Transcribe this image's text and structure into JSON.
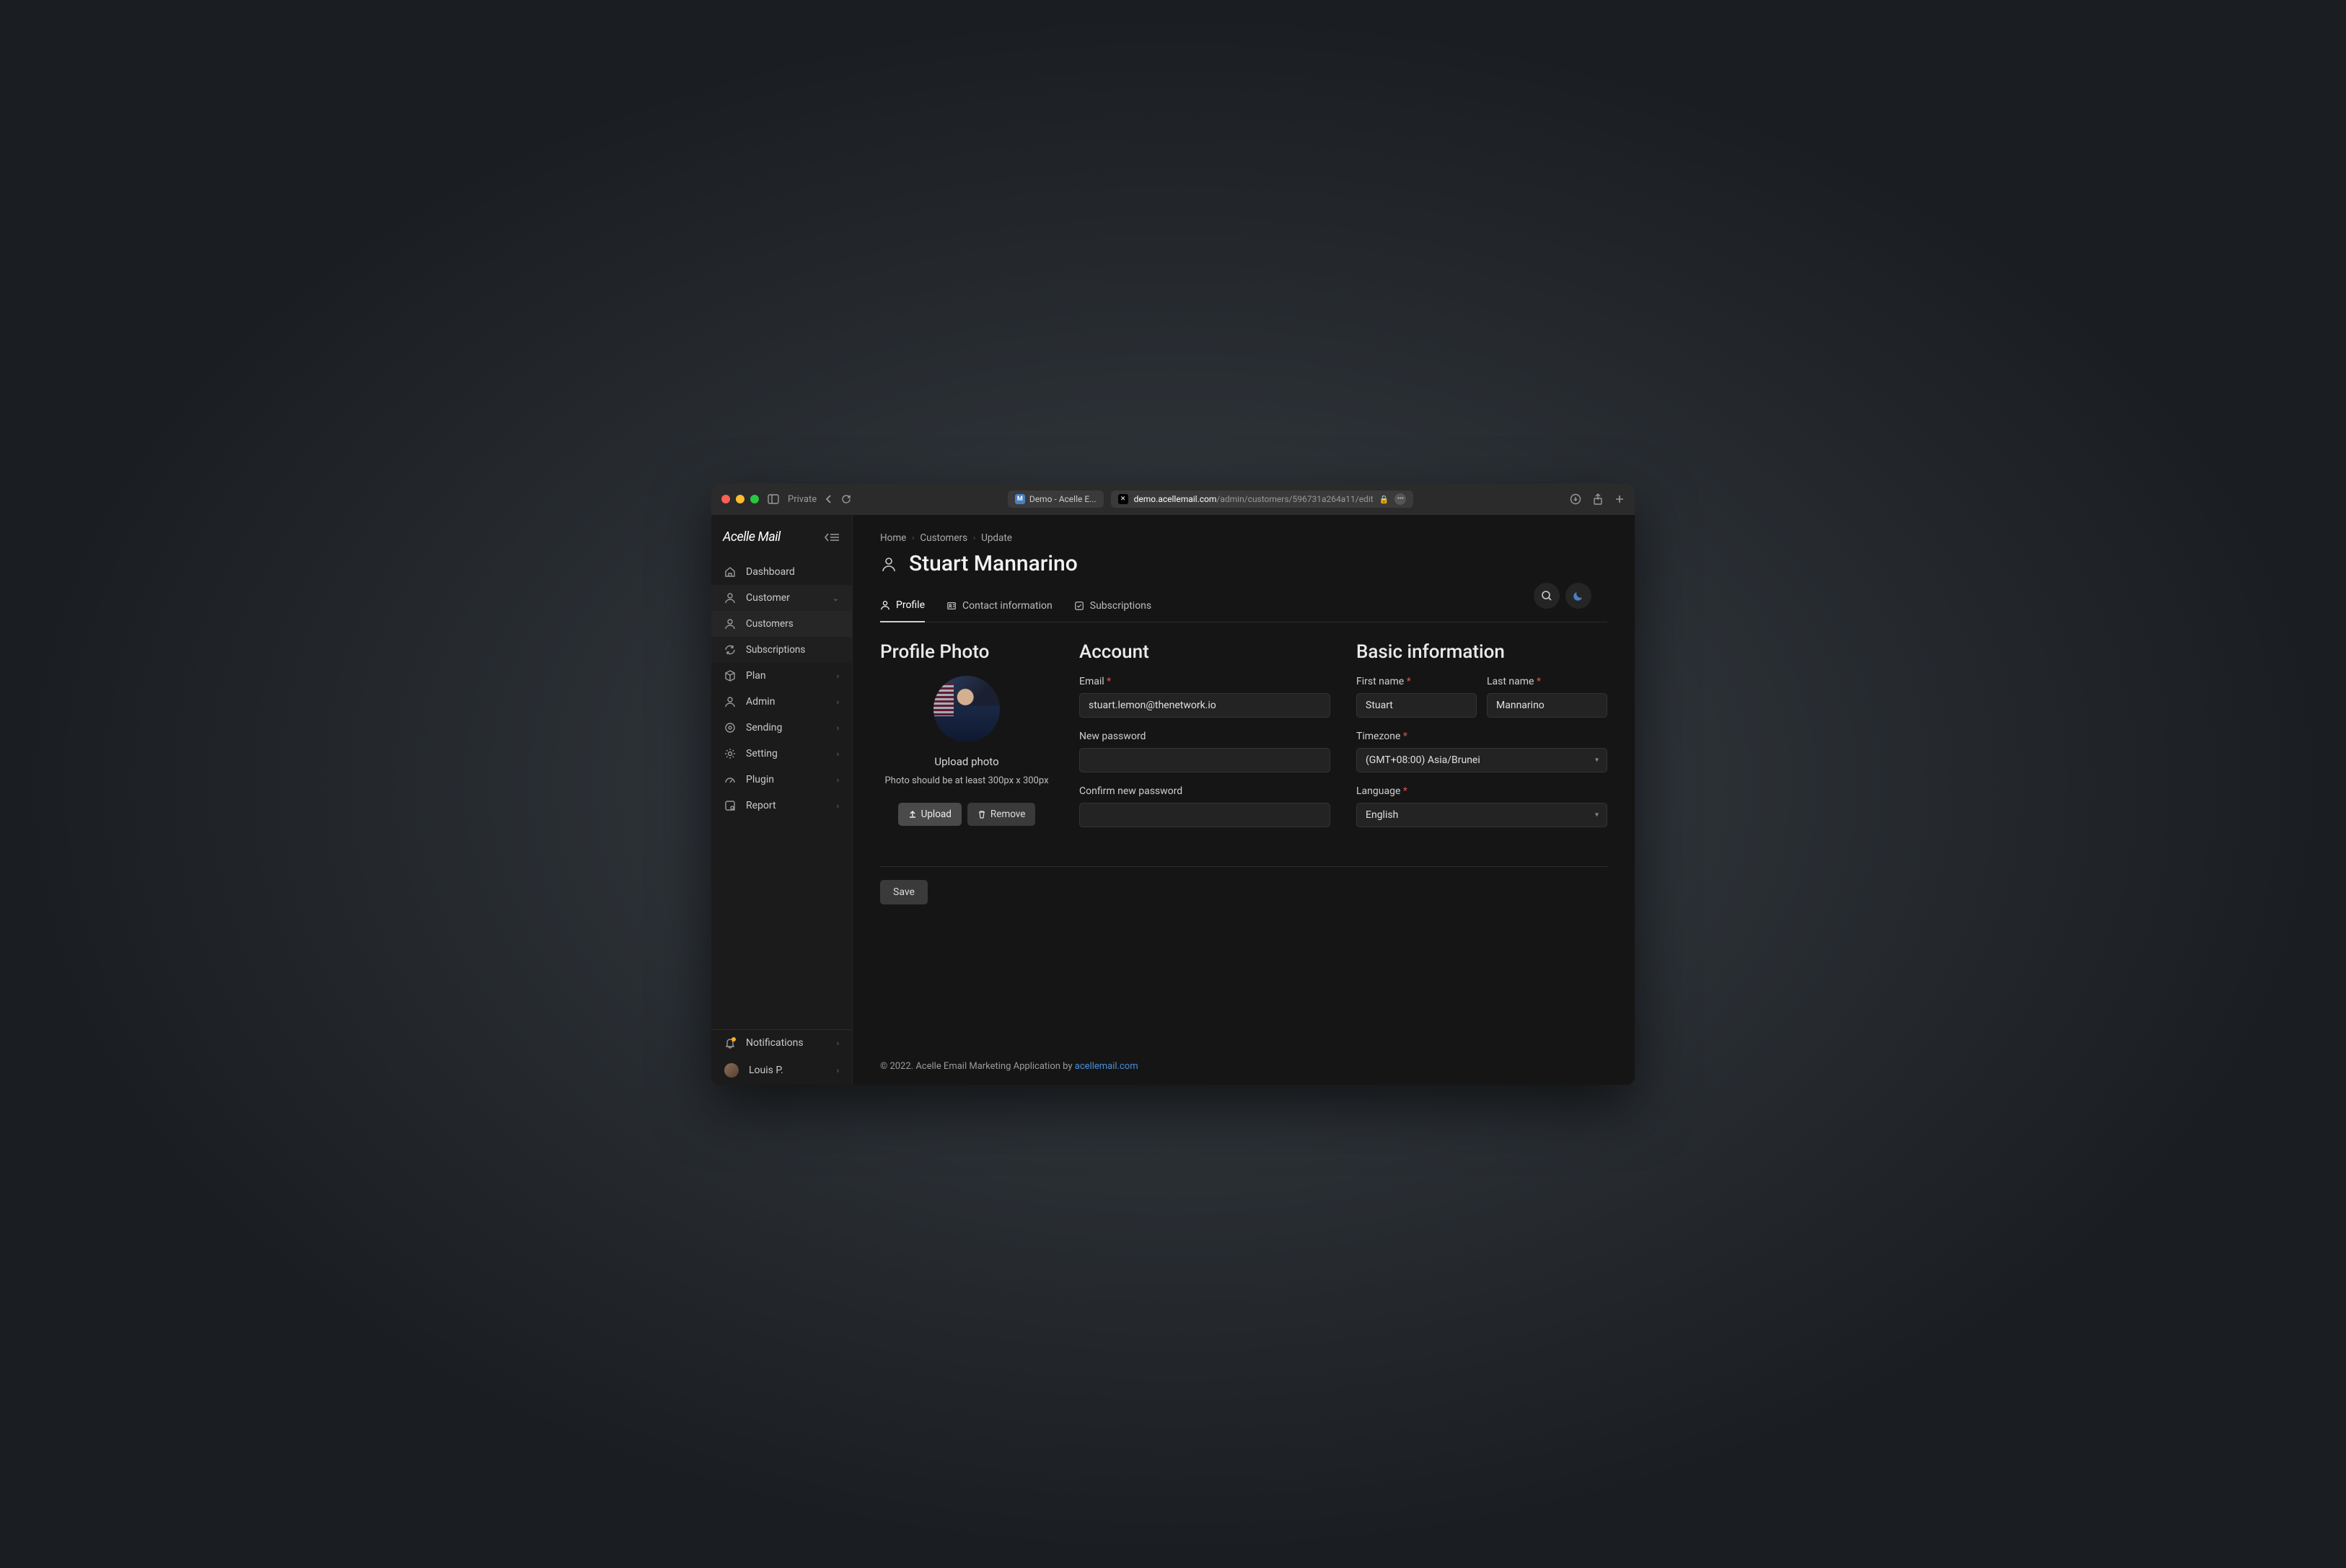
{
  "browser": {
    "private_label": "Private",
    "tab_title": "Demo - Acelle E...",
    "url_domain": "demo.acellemail.com",
    "url_path": "/admin/customers/596731a264a11/edit"
  },
  "logo": "Acelle Mail",
  "sidebar": {
    "items": [
      {
        "label": "Dashboard",
        "icon": "home"
      },
      {
        "label": "Customer",
        "icon": "user",
        "expanded": true,
        "children": [
          {
            "label": "Customers",
            "icon": "user",
            "active": true
          },
          {
            "label": "Subscriptions",
            "icon": "refresh"
          }
        ]
      },
      {
        "label": "Plan",
        "icon": "box",
        "chevron": true
      },
      {
        "label": "Admin",
        "icon": "user",
        "chevron": true
      },
      {
        "label": "Sending",
        "icon": "target",
        "chevron": true
      },
      {
        "label": "Setting",
        "icon": "gear",
        "chevron": true
      },
      {
        "label": "Plugin",
        "icon": "gauge",
        "chevron": true
      },
      {
        "label": "Report",
        "icon": "report",
        "chevron": true
      }
    ],
    "notifications_label": "Notifications",
    "user_name": "Louis P."
  },
  "breadcrumb": [
    "Home",
    "Customers",
    "Update"
  ],
  "page_title": "Stuart Mannarino",
  "tabs": [
    {
      "label": "Profile",
      "icon": "user",
      "active": true
    },
    {
      "label": "Contact information",
      "icon": "contact"
    },
    {
      "label": "Subscriptions",
      "icon": "check"
    }
  ],
  "sections": {
    "photo": {
      "title": "Profile Photo",
      "upload_title": "Upload photo",
      "hint": "Photo should be at least 300px x 300px",
      "upload_btn": "Upload",
      "remove_btn": "Remove"
    },
    "account": {
      "title": "Account",
      "email_label": "Email",
      "email_value": "stuart.lemon@thenetwork.io",
      "newpw_label": "New password",
      "confirmpw_label": "Confirm new password"
    },
    "basic": {
      "title": "Basic information",
      "firstname_label": "First name",
      "firstname_value": "Stuart",
      "lastname_label": "Last name",
      "lastname_value": "Mannarino",
      "timezone_label": "Timezone",
      "timezone_value": "(GMT+08:00) Asia/Brunei",
      "language_label": "Language",
      "language_value": "English"
    }
  },
  "save_label": "Save",
  "footer": {
    "text": "© 2022. Acelle Email Marketing Application by ",
    "link": "acellemail.com"
  }
}
